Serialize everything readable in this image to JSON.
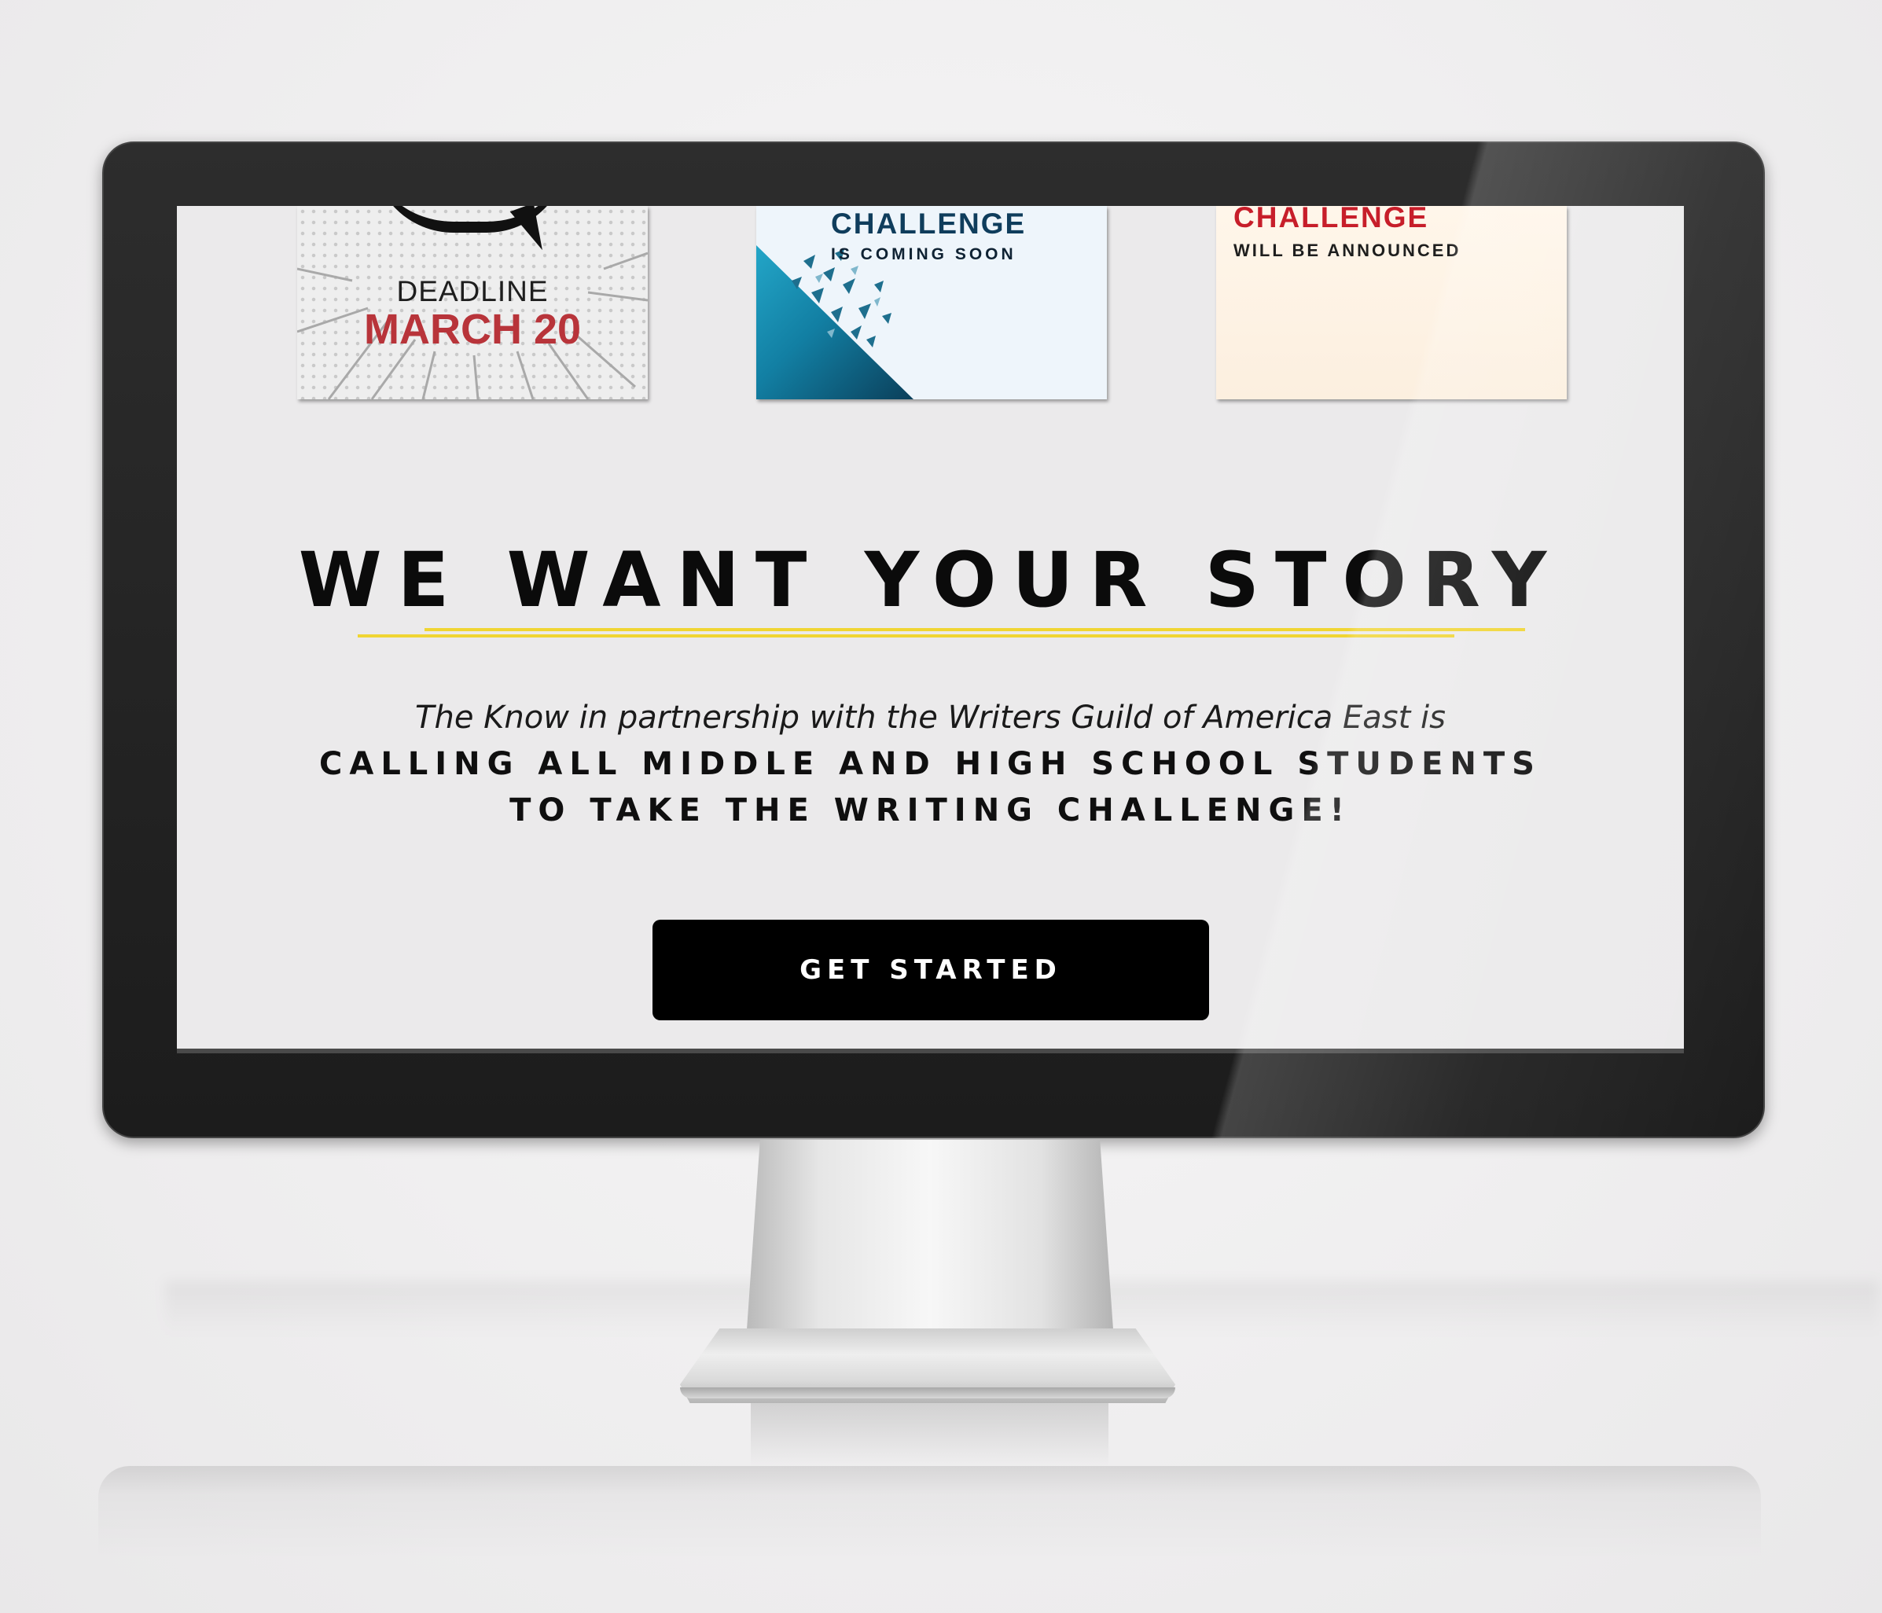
{
  "cards": [
    {
      "label_top": "DEADLINE",
      "label_big": "MARCH 20"
    },
    {
      "title": "CHALLENGE",
      "subtitle": "IS COMING SOON"
    },
    {
      "title": "CHALLENGE",
      "subtitle": "WILL BE ANNOUNCED"
    }
  ],
  "hero": {
    "headline": "WE WANT YOUR STORY",
    "intro": "The Know in partnership with the Writers Guild of America East is",
    "call_line_1": "CALLING ALL MIDDLE AND HIGH SCHOOL STUDENTS",
    "call_line_2": "TO TAKE THE WRITING CHALLENGE!"
  },
  "cta": {
    "label": "GET STARTED"
  },
  "colors": {
    "accent_red": "#b8343a",
    "accent_teal": "#0f3d5c",
    "underline_yellow": "#f0d533",
    "button_bg": "#000000"
  }
}
